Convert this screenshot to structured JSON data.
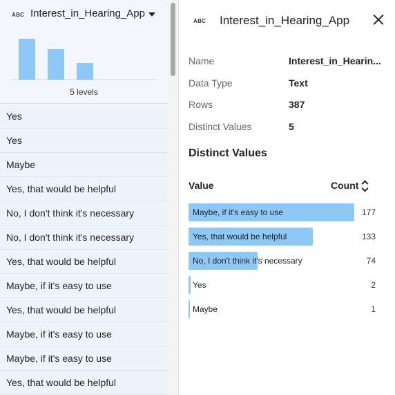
{
  "column": {
    "type_icon": "ABC",
    "title": "Interest_in_Hearing_App",
    "levels_text": "5 levels",
    "histogram": [
      177,
      133,
      74,
      2,
      1
    ]
  },
  "rows": [
    "Yes",
    "Yes",
    "Maybe",
    "Yes, that would be helpful",
    "No, I don't think it's necessary",
    "No, I don't think it's necessary",
    "Yes, that would be helpful",
    "Maybe, if it's easy to use",
    "Yes, that would be helpful",
    "Maybe, if it's easy to use",
    "Maybe, if it's easy to use",
    "Yes, that would be helpful"
  ],
  "panel": {
    "type_icon": "ABC",
    "title": "Interest_in_Hearing_App",
    "meta": [
      {
        "label": "Name",
        "value": "Interest_in_Hearin..."
      },
      {
        "label": "Data Type",
        "value": "Text"
      },
      {
        "label": "Rows",
        "value": "387"
      },
      {
        "label": "Distinct Values",
        "value": "5"
      }
    ],
    "section_title": "Distinct Values",
    "table": {
      "value_header": "Value",
      "count_header": "Count",
      "max_count": 177,
      "items": [
        {
          "value": "Maybe, if it's easy to use",
          "count": "177"
        },
        {
          "value": "Yes, that would be helpful",
          "count": "133"
        },
        {
          "value": "No, I don't think it's necessary",
          "count": "74"
        },
        {
          "value": "Yes",
          "count": "2"
        },
        {
          "value": "Maybe",
          "count": "1"
        }
      ]
    }
  },
  "colors": {
    "bar": "#8ec8f7",
    "row_bg": "#edf3fb",
    "header_bg": "#f3f6fb"
  }
}
